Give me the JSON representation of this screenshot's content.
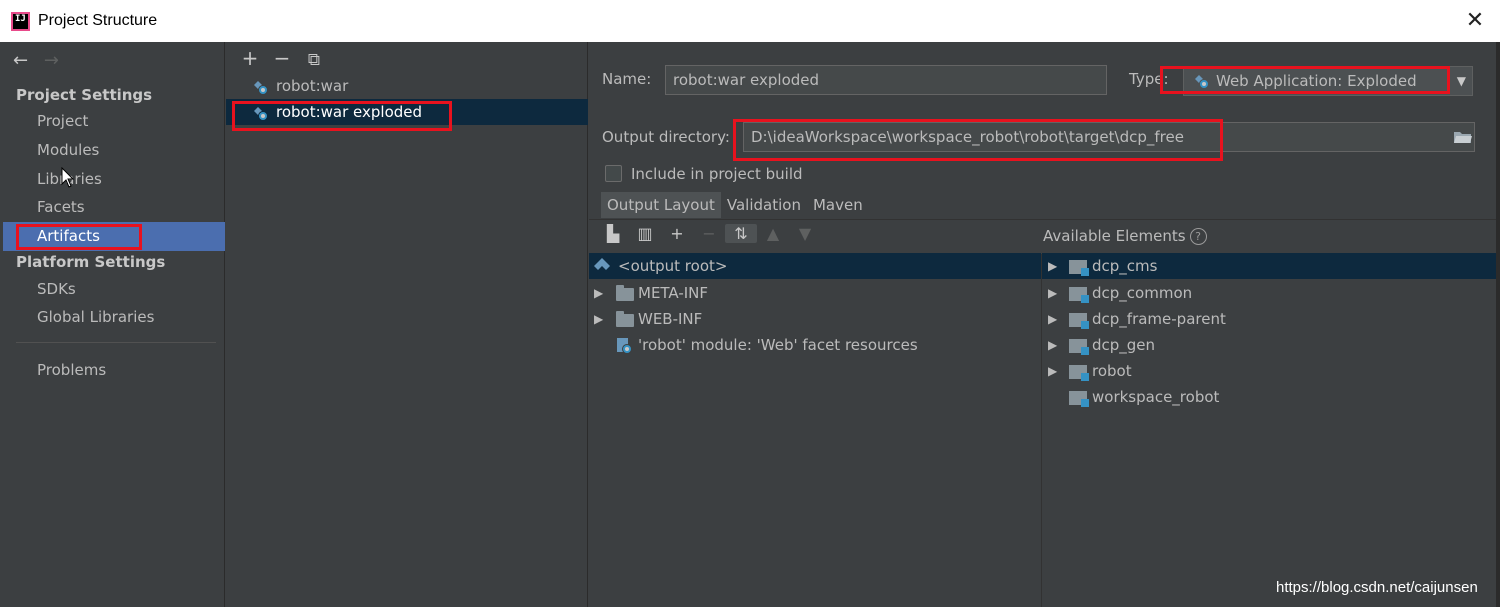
{
  "window": {
    "title": "Project Structure",
    "close_label": "✕"
  },
  "nav": {
    "back": "←",
    "forward": "→",
    "project_settings_title": "Project Settings",
    "project_items": [
      "Project",
      "Modules",
      "Libraries",
      "Facets",
      "Artifacts"
    ],
    "platform_settings_title": "Platform Settings",
    "platform_items": [
      "SDKs",
      "Global Libraries"
    ],
    "problems": "Problems",
    "selected": "Artifacts"
  },
  "artifacts": {
    "toolbar": {
      "add": "+",
      "remove": "−",
      "copy": "⧉"
    },
    "items": [
      "robot:war",
      "robot:war exploded"
    ],
    "selected": "robot:war exploded"
  },
  "config": {
    "name_label": "Name:",
    "name_value": "robot:war exploded",
    "type_label": "Type:",
    "type_value": "Web Application: Exploded",
    "output_dir_label": "Output directory:",
    "output_dir_value": "D:\\ideaWorkspace\\workspace_robot\\robot\\target\\dcp_free",
    "include_label": "Include in project build",
    "include_checked": false,
    "tabs": [
      "Output Layout",
      "Validation",
      "Maven"
    ],
    "active_tab": "Output Layout",
    "layout_tree": [
      {
        "label": "<output root>",
        "icon": "web-artifact-icon"
      },
      {
        "label": "META-INF",
        "icon": "folder-icon"
      },
      {
        "label": "WEB-INF",
        "icon": "folder-icon"
      },
      {
        "label": "'robot' module: 'Web' facet resources",
        "icon": "web-facet-icon"
      }
    ],
    "available_title": "Available Elements",
    "available": [
      "dcp_cms",
      "dcp_common",
      "dcp_frame-parent",
      "dcp_gen",
      "robot",
      "workspace_robot"
    ]
  },
  "watermark": "https://blog.csdn.net/caijunsen",
  "colors": {
    "background": "#3c3f41",
    "selection": "#4b6eaf",
    "list_selection": "#0d293e",
    "highlight_box": "#e8121e"
  }
}
